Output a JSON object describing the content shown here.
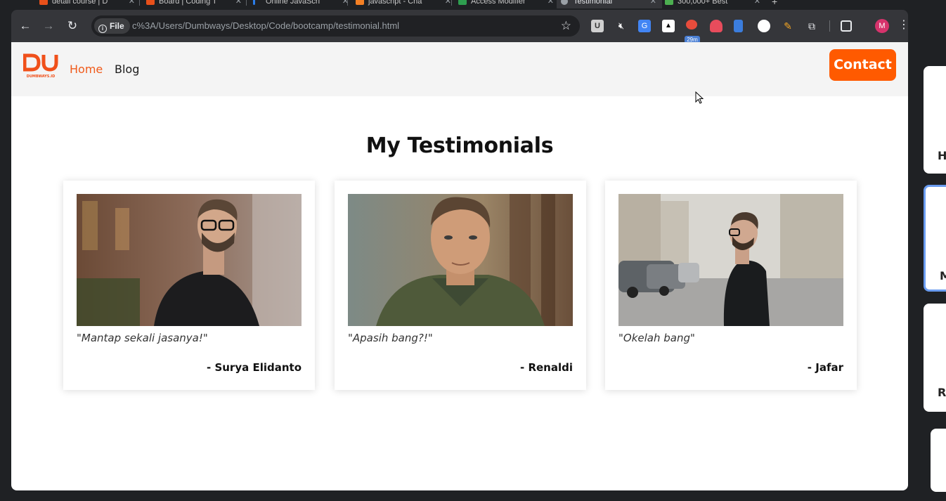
{
  "browser": {
    "tabs": [
      {
        "title": "detail course | D"
      },
      {
        "title": "Board | Coding T"
      },
      {
        "title": "Online JavaScri"
      },
      {
        "title": "javascript - Cha"
      },
      {
        "title": "Access Modifier"
      },
      {
        "title": "Testimonial"
      },
      {
        "title": "300,000+ Best"
      }
    ],
    "address": {
      "chip_label": "File",
      "url": "c%3A/Users/Dumbways/Desktop/Code/bootcamp/testimonial.html"
    },
    "extension_badge": "29m",
    "profile_initial": "M"
  },
  "site": {
    "brand": "DUMBWAYS.ID",
    "nav": {
      "home": "Home",
      "blog": "Blog"
    },
    "contact_label": "Contact",
    "heading": "My Testimonials",
    "accent_color": "#ff5a00",
    "testimonials": [
      {
        "quote": "\"Mantap sekali jasanya!\"",
        "author": "- Surya Elidanto"
      },
      {
        "quote": "\"Apasih bang?!\"",
        "author": "- Renaldi"
      },
      {
        "quote": "\"Okelah bang\"",
        "author": "- Jafar"
      }
    ]
  },
  "side_panel": {
    "items": [
      {
        "initial": "H"
      },
      {
        "initial": "M"
      },
      {
        "initial": "Ri"
      }
    ]
  }
}
